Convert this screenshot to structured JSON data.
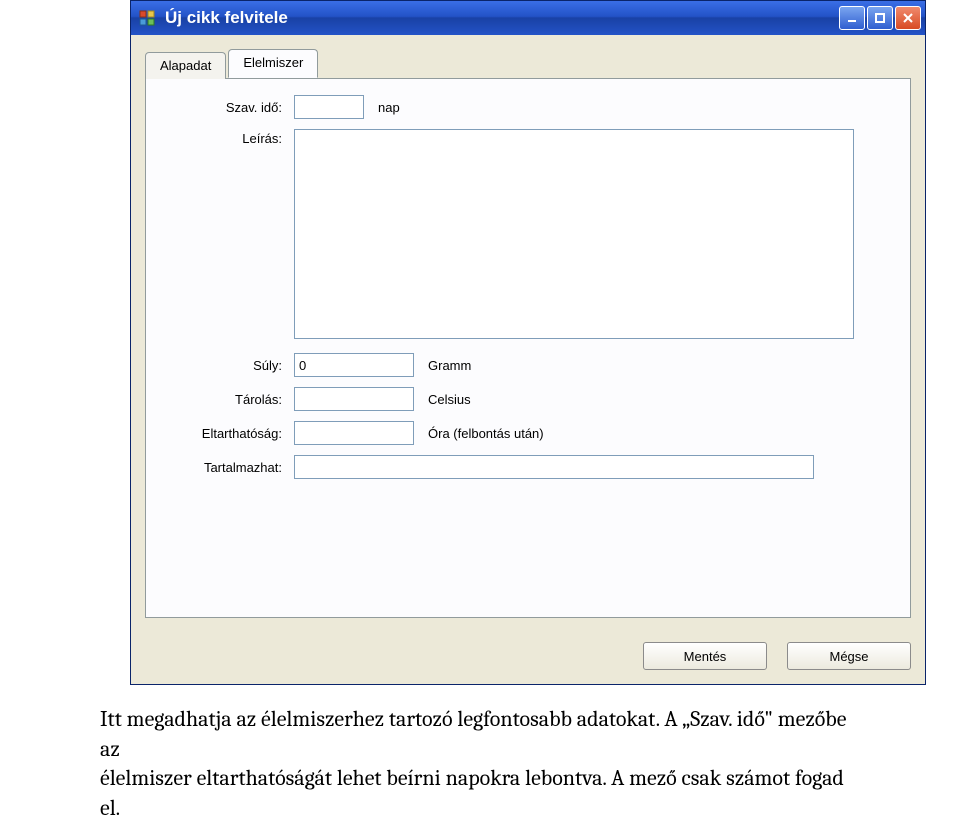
{
  "window": {
    "title": "Új cikk felvitele"
  },
  "tabs": {
    "alapadat": "Alapadat",
    "elelmiszer": "Elelmiszer"
  },
  "fields": {
    "szav_ido": {
      "label": "Szav. idő:",
      "value": "",
      "unit": "nap"
    },
    "leiras": {
      "label": "Leírás:",
      "value": ""
    },
    "suly": {
      "label": "Súly:",
      "value": "0",
      "unit": "Gramm"
    },
    "tarolas": {
      "label": "Tárolás:",
      "value": "",
      "unit": "Celsius"
    },
    "eltarthatosag": {
      "label": "Eltarthatóság:",
      "value": "",
      "unit": "Óra (felbontás után)"
    },
    "tartalmazhat": {
      "label": "Tartalmazhat:",
      "value": ""
    }
  },
  "buttons": {
    "save": "Mentés",
    "cancel": "Mégse"
  },
  "caption": {
    "line1": "Itt megadhatja az élelmiszerhez tartozó legfontosabb adatokat. A „Szav. idő\" mezőbe az",
    "line2": "élelmiszer eltarthatóságát lehet beírni napokra lebontva. A mező csak számot fogad el."
  }
}
